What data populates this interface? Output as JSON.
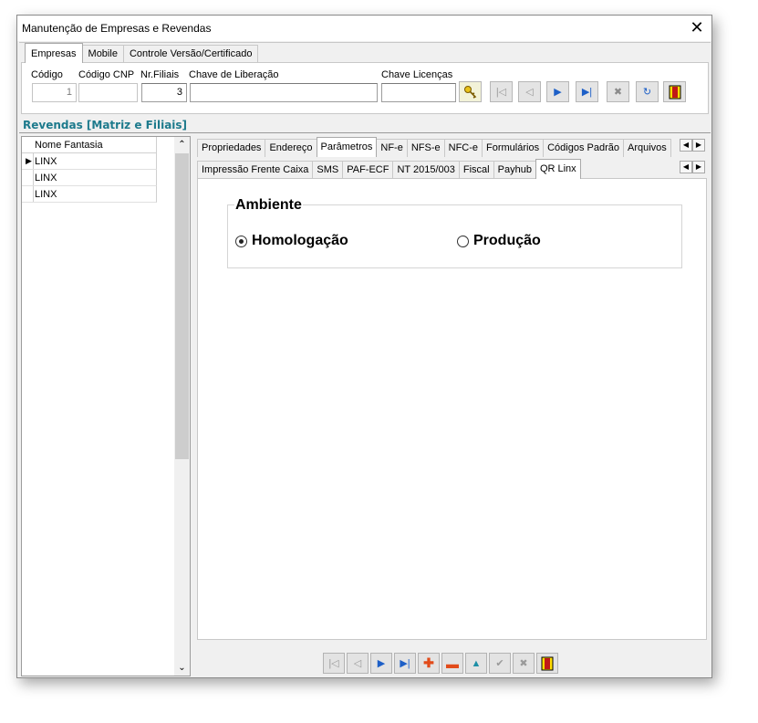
{
  "window": {
    "title": "Manutenção de Empresas e Revendas"
  },
  "top_tabs": [
    "Empresas",
    "Mobile",
    "Controle Versão/Certificado"
  ],
  "fields": {
    "codigo": {
      "label": "Código",
      "value": "1"
    },
    "codigo_cnp": {
      "label": "Código CNP",
      "value": ""
    },
    "nr_filiais": {
      "label": "Nr.Filiais",
      "value": "3"
    },
    "chave_liberacao": {
      "label": "Chave de Liberação",
      "value": ""
    },
    "chave_licencas": {
      "label": "Chave Licenças",
      "value": ""
    }
  },
  "section_title": "Revendas [Matriz e Filiais]",
  "grid": {
    "header": "Nome Fantasia",
    "rows": [
      "LINX",
      "LINX",
      "LINX"
    ]
  },
  "tabs_row1": [
    "Propriedades",
    "Endereço",
    "Parâmetros",
    "NF-e",
    "NFS-e",
    "NFC-e",
    "Formulários",
    "Códigos Padrão",
    "Arquivos"
  ],
  "tabs_row2": [
    "Impressão Frente Caixa",
    "SMS",
    "PAF-ECF",
    "NT 2015/003",
    "Fiscal",
    "Payhub",
    "QR Linx"
  ],
  "ambiente": {
    "legend": "Ambiente",
    "options": [
      "Homologação",
      "Produção"
    ],
    "selected": "Homologação"
  }
}
